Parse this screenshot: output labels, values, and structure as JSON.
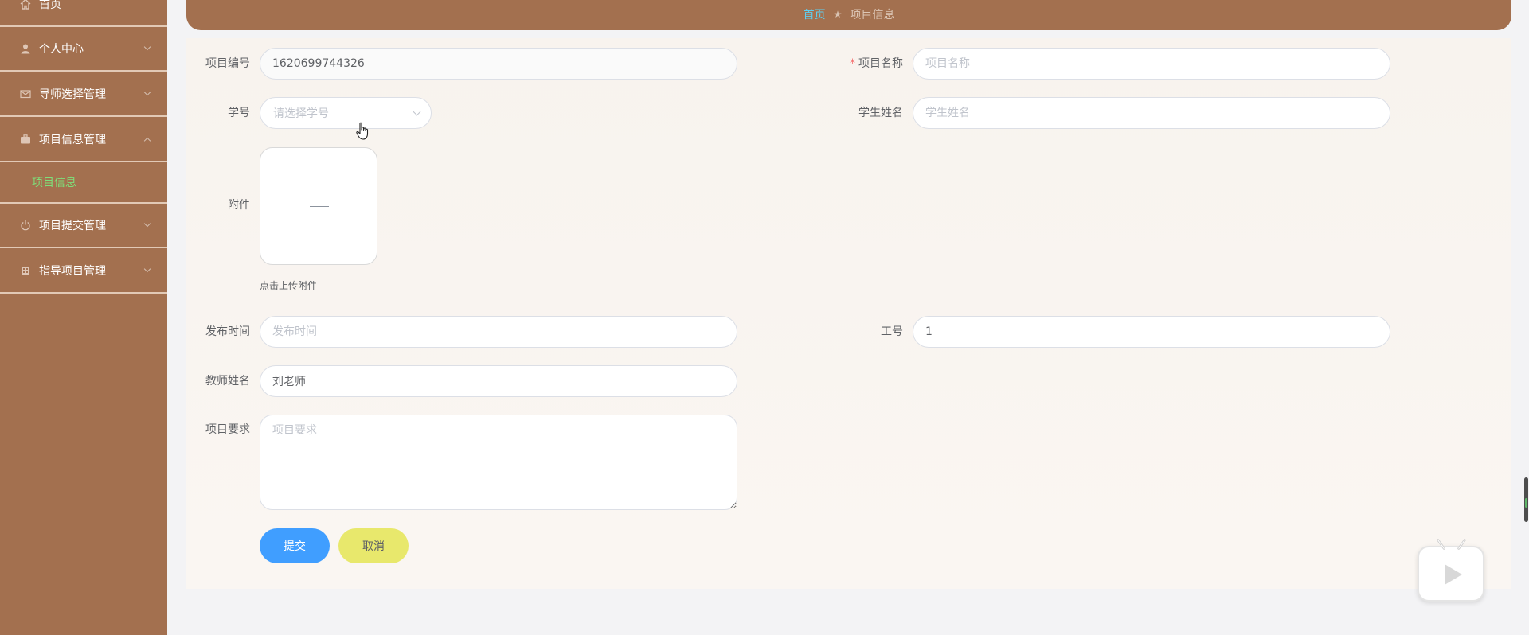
{
  "sidebar": {
    "items": [
      {
        "label": "首页",
        "icon": "home-icon"
      },
      {
        "label": "个人中心",
        "icon": "user-icon"
      },
      {
        "label": "导师选择管理",
        "icon": "mail-icon"
      },
      {
        "label": "项目信息管理",
        "icon": "briefcase-icon",
        "expanded": true
      },
      {
        "label": "项目提交管理",
        "icon": "power-icon"
      },
      {
        "label": "指导项目管理",
        "icon": "building-icon"
      }
    ],
    "active_sub": "项目信息"
  },
  "breadcrumb": {
    "home": "首页",
    "separator": "★",
    "current": "项目信息"
  },
  "form": {
    "project_no": {
      "label": "项目编号",
      "value": "1620699744326"
    },
    "project_name": {
      "label": "项目名称",
      "placeholder": "项目名称",
      "required_mark": "*"
    },
    "student_no": {
      "label": "学号",
      "placeholder": "请选择学号"
    },
    "student_name": {
      "label": "学生姓名",
      "placeholder": "学生姓名"
    },
    "attachment": {
      "label": "附件",
      "tip": "点击上传附件"
    },
    "publish_time": {
      "label": "发布时间",
      "placeholder": "发布时间"
    },
    "teacher_no": {
      "label": "工号",
      "value": "1"
    },
    "teacher_name": {
      "label": "教师姓名",
      "value": "刘老师"
    },
    "requirement": {
      "label": "项目要求",
      "placeholder": "项目要求"
    },
    "submit_label": "提交",
    "cancel_label": "取消"
  },
  "colors": {
    "sidebar_bg": "#a3704f",
    "submenu_active": "#7ee07a",
    "crumb_home": "#5ecff0",
    "submit": "#409eff",
    "cancel": "#e8e86c"
  }
}
